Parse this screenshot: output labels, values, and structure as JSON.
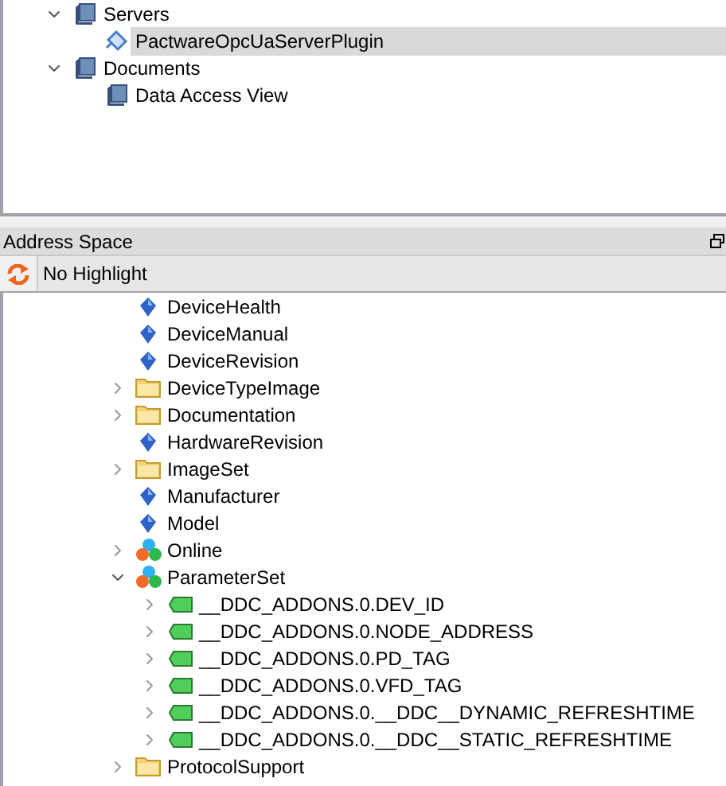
{
  "top_tree": [
    {
      "label": "Servers",
      "kind": "book",
      "expanded": true,
      "selected": false,
      "children": [
        {
          "label": "PactwareOpcUaServerPlugin",
          "kind": "plugin",
          "selected": true
        }
      ]
    },
    {
      "label": "Documents",
      "kind": "book",
      "expanded": true,
      "selected": false,
      "children": [
        {
          "label": "Data Access View",
          "kind": "book",
          "selected": false
        }
      ]
    }
  ],
  "panel": {
    "title": "Address Space"
  },
  "toolbar": {
    "highlight": "No Highlight"
  },
  "tree": [
    {
      "label": "DeviceHealth",
      "kind": "property"
    },
    {
      "label": "DeviceManual",
      "kind": "property"
    },
    {
      "label": "DeviceRevision",
      "kind": "property"
    },
    {
      "label": "DeviceTypeImage",
      "kind": "folder",
      "expanded": false
    },
    {
      "label": "Documentation",
      "kind": "folder",
      "expanded": false
    },
    {
      "label": "HardwareRevision",
      "kind": "property"
    },
    {
      "label": "ImageSet",
      "kind": "folder",
      "expanded": false
    },
    {
      "label": "Manufacturer",
      "kind": "property"
    },
    {
      "label": "Model",
      "kind": "property"
    },
    {
      "label": "Online",
      "kind": "object",
      "expanded": false
    },
    {
      "label": "ParameterSet",
      "kind": "object",
      "expanded": true,
      "children": [
        {
          "label": "__DDC_ADDONS.0.DEV_ID",
          "kind": "tag",
          "expanded": false
        },
        {
          "label": "__DDC_ADDONS.0.NODE_ADDRESS",
          "kind": "tag",
          "expanded": false
        },
        {
          "label": "__DDC_ADDONS.0.PD_TAG",
          "kind": "tag",
          "expanded": false
        },
        {
          "label": "__DDC_ADDONS.0.VFD_TAG",
          "kind": "tag",
          "expanded": false
        },
        {
          "label": "__DDC_ADDONS.0.__DDC__DYNAMIC_REFRESHTIME",
          "kind": "tag",
          "expanded": false
        },
        {
          "label": "__DDC_ADDONS.0.__DDC__STATIC_REFRESHTIME",
          "kind": "tag",
          "expanded": false
        }
      ]
    },
    {
      "label": "ProtocolSupport",
      "kind": "folder",
      "expanded": false
    }
  ]
}
